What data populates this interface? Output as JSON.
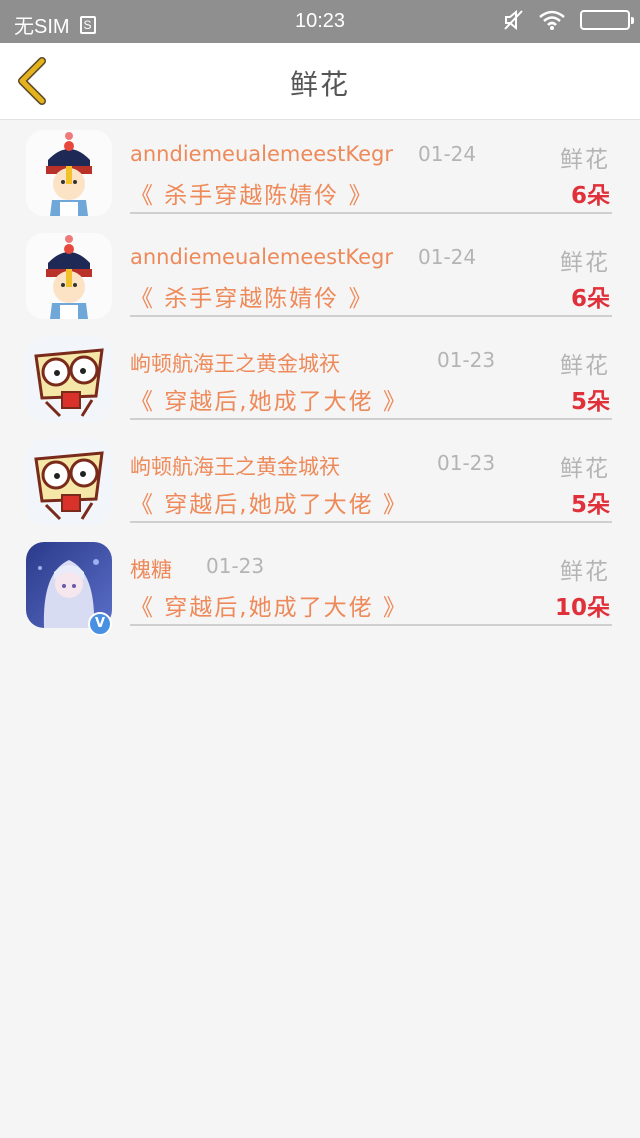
{
  "status_bar": {
    "carrier": "无SIM",
    "sim_icon_text": "S",
    "time": "10:23"
  },
  "header": {
    "title": "鲜花",
    "back_icon": "chevron-left-icon",
    "back_color": "#e4b21c"
  },
  "colors": {
    "accent": "#ee8a5a",
    "count": "#e0303a",
    "muted": "#b4b4b4"
  },
  "records": [
    {
      "user": "anndiemeualemeestKegr",
      "date": "01-24",
      "label": "鲜花",
      "book": "《 杀手穿越陈婧伶 》",
      "count": "6朵",
      "avatar": "cartoon-official"
    },
    {
      "user": "anndiemeualemeestKegr",
      "date": "01-24",
      "label": "鲜花",
      "book": "《 杀手穿越陈婧伶 》",
      "count": "6朵",
      "avatar": "cartoon-official"
    },
    {
      "user": "岣顿航海王之黄金城祆",
      "date": "01-23",
      "label": "鲜花",
      "book": "《 穿越后,她成了大佬 》",
      "count": "5朵",
      "avatar": "cartoon-creature"
    },
    {
      "user": "岣顿航海王之黄金城祆",
      "date": "01-23",
      "label": "鲜花",
      "book": "《 穿越后,她成了大佬 》",
      "count": "5朵",
      "avatar": "cartoon-creature"
    },
    {
      "user": "槐糖",
      "date": "01-23",
      "label": "鲜花",
      "book": "《 穿越后,她成了大佬 》",
      "count": "10朵",
      "avatar": "anime-girl",
      "verified": "V"
    }
  ]
}
